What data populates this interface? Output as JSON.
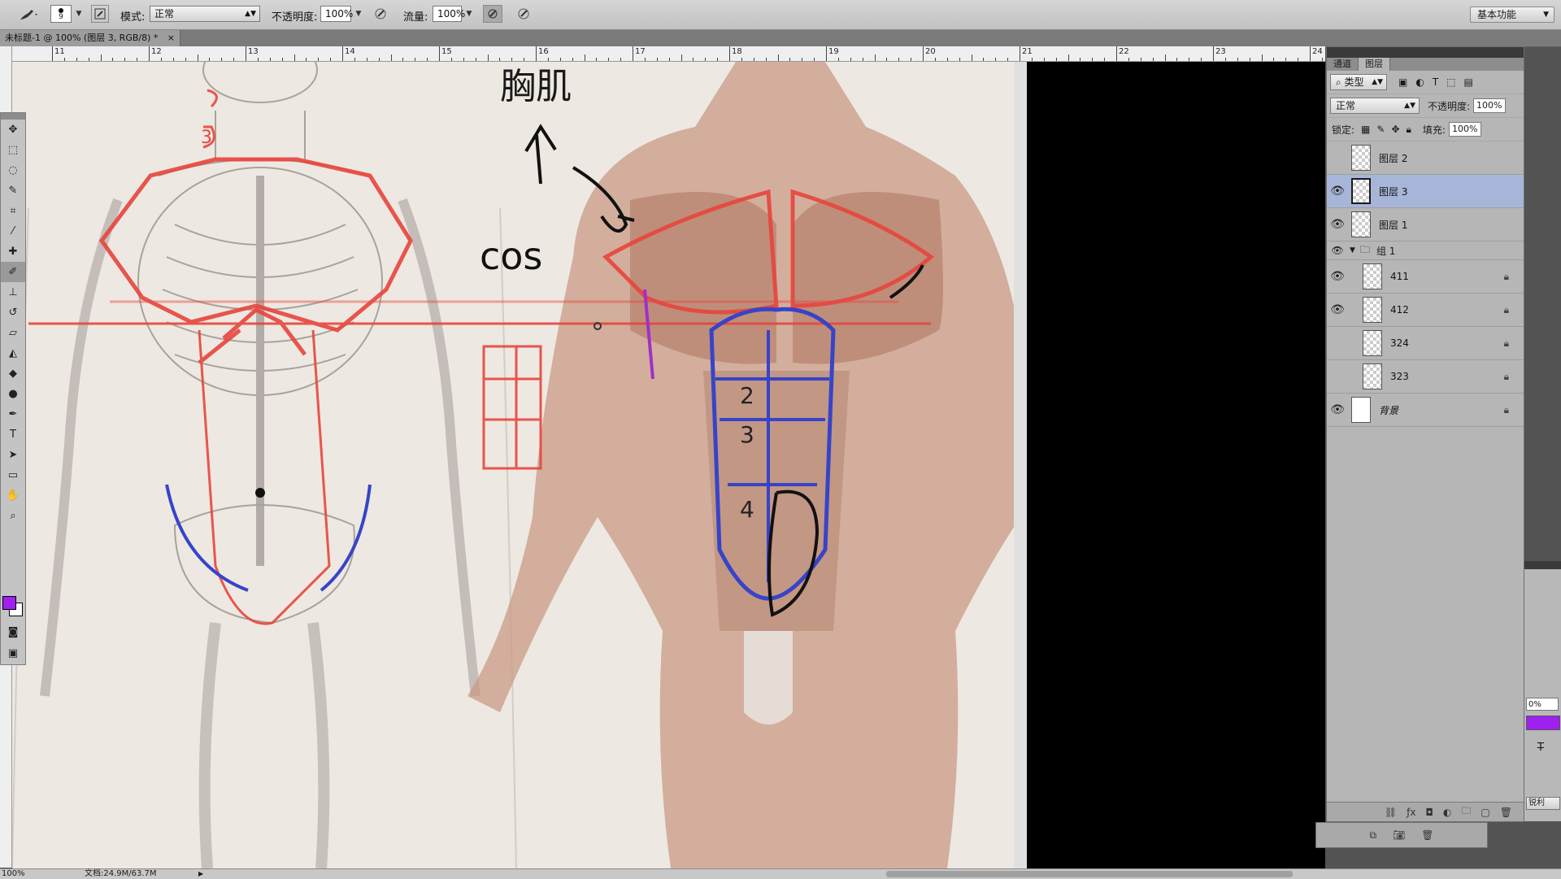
{
  "options_bar": {
    "brush_size": "9",
    "mode_label": "模式:",
    "mode_value": "正常",
    "opacity_label": "不透明度:",
    "opacity_value": "100%",
    "flow_label": "流量:",
    "flow_value": "100%",
    "workspace": "基本功能"
  },
  "document_tab": {
    "title": "未标题-1 @ 100% (图层 3, RGB/8) *",
    "close": "×"
  },
  "ruler": {
    "top_numbers": [
      "11",
      "12",
      "13",
      "14",
      "15",
      "16",
      "17",
      "18",
      "19",
      "20",
      "21",
      "22",
      "23",
      "24"
    ]
  },
  "canvas": {
    "sketch_text": {
      "top_chinese": "胸肌",
      "cos": "cos",
      "rib_mark": "3",
      "abs_numbers": [
        "2",
        "3",
        "4"
      ]
    }
  },
  "tools": {
    "foreground_color": "#a020f0",
    "background_color": "#ffffff",
    "icons": [
      "move",
      "marquee",
      "lasso",
      "quick-select",
      "crop",
      "eyedropper",
      "healing",
      "brush",
      "stamp",
      "history-brush",
      "eraser",
      "paint-bucket",
      "blur",
      "dodge",
      "pen",
      "type",
      "path-select",
      "shape",
      "hand",
      "zoom"
    ]
  },
  "layers_panel": {
    "tabs": [
      "通道",
      "图层"
    ],
    "filter_label": "类型",
    "blend_mode": "正常",
    "opacity_label": "不透明度:",
    "opacity_value": "100%",
    "lock_label": "锁定:",
    "fill_label": "填充:",
    "fill_value": "100%",
    "layers": [
      {
        "name": "图层 2",
        "visible": false
      },
      {
        "name": "图层 3",
        "visible": true,
        "selected": true
      },
      {
        "name": "图层 1",
        "visible": true
      }
    ],
    "group": {
      "name": "组 1",
      "visible": true
    },
    "group_layers": [
      {
        "name": "411",
        "visible": true
      },
      {
        "name": "412",
        "visible": true
      },
      {
        "name": "324",
        "visible": false
      },
      {
        "name": "323",
        "visible": false
      }
    ],
    "background_layer": {
      "name": "背景",
      "visible": true
    }
  },
  "right_panel": {
    "percent": "0%",
    "swatch_color": "#a020f0",
    "bottom_text": "锐利"
  },
  "status_bar": {
    "zoom": "100%",
    "doc_info": "文档:24.9M/63.7M"
  }
}
